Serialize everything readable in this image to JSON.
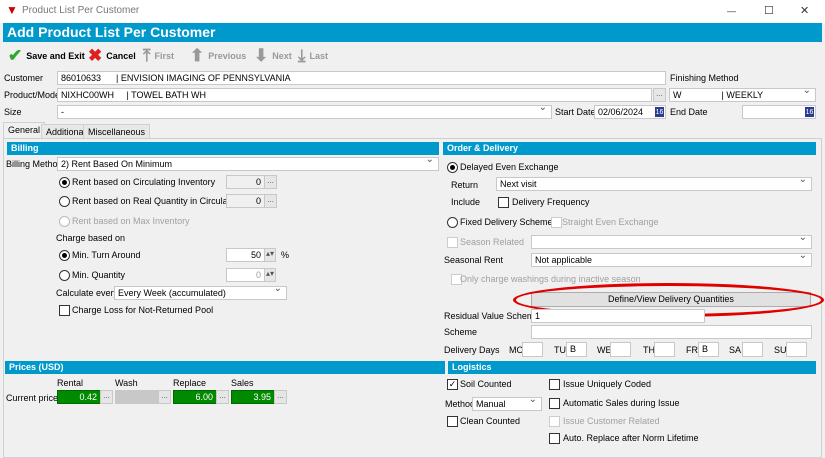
{
  "window": {
    "title": "Product List Per Customer",
    "minimize": "—",
    "maximize": "☐",
    "close": "✕"
  },
  "header": {
    "title": "Add Product List Per Customer"
  },
  "toolbar": {
    "save": "Save and Exit",
    "cancel": "Cancel",
    "first": "First",
    "previous": "Previous",
    "next": "Next",
    "last": "Last"
  },
  "form": {
    "customer_label": "Customer",
    "customer_value": "86010633      | ENVISION IMAGING OF PENNSYLVANIA",
    "product_label": "Product/Model",
    "product_value": "NIXHC00WH     | TOWEL BATH WH",
    "size_label": "Size",
    "size_value": "-",
    "finishing_label": "Finishing Method",
    "finishing_value": "W                | WEEKLY",
    "start_label": "Start Date",
    "start_value": "02/06/2024",
    "end_label": "End Date",
    "end_value": "",
    "calendar": "16"
  },
  "tabs": [
    "General",
    "Additional",
    "Miscellaneous"
  ],
  "billing": {
    "title": "Billing",
    "method_label": "Billing Method",
    "method_value": "2) Rent Based On Minimum",
    "opt1": "Rent based on Circulating Inventory",
    "opt1_value": "0",
    "opt2": "Rent based on Real Quantity in Circulation",
    "opt2_value": "0",
    "opt3": "Rent based on Max Inventory",
    "charge_label": "Charge based on",
    "min_turn": "Min. Turn Around",
    "min_turn_value": "50",
    "percent": "%",
    "min_qty": "Min. Quantity",
    "min_qty_value": "0",
    "calc_label": "Calculate every",
    "calc_value": "Every Week (accumulated)",
    "charge_loss": "Charge Loss for Not-Returned Pool",
    "dots": "..."
  },
  "order": {
    "title": "Order & Delivery",
    "delayed": "Delayed Even Exchange",
    "return_label": "Return",
    "return_value": "Next visit",
    "include_label": "Include",
    "delivery_freq": "Delivery Frequency",
    "fixed": "Fixed Delivery Scheme",
    "straight": "Straight Even Exchange",
    "season_related": "Season Related",
    "seasonal_rent_label": "Seasonal Rent",
    "seasonal_rent_value": "Not applicable",
    "only_charge": "Only charge washings during inactive season",
    "define_button": "Define/View Delivery Quantities",
    "residual_label": "Residual Value Scheme",
    "residual_value": "1",
    "scheme_label": "Scheme",
    "scheme_value": "",
    "days_label": "Delivery Days",
    "days": [
      {
        "d": "MO",
        "v": ""
      },
      {
        "d": "TU",
        "v": "B"
      },
      {
        "d": "WE",
        "v": ""
      },
      {
        "d": "TH",
        "v": ""
      },
      {
        "d": "FR",
        "v": "B"
      },
      {
        "d": "SA",
        "v": ""
      },
      {
        "d": "SU",
        "v": ""
      }
    ]
  },
  "prices": {
    "title": "Prices (USD)",
    "rental": "Rental",
    "wash": "Wash",
    "replace": "Replace",
    "sales": "Sales",
    "current_label": "Current price",
    "rental_value": "0.42",
    "wash_value": "",
    "replace_value": "6.00",
    "sales_value": "3.95"
  },
  "logistics": {
    "title": "Logistics",
    "soil": "Soil Counted",
    "soil_check": "✓",
    "method_label": "Method",
    "method_value": "Manual",
    "clean": "Clean Counted",
    "issue_unique": "Issue Uniquely Coded",
    "auto_sales": "Automatic Sales during Issue",
    "issue_customer": "Issue Customer Related",
    "auto_replace": "Auto. Replace after Norm Lifetime"
  },
  "colors": {
    "accent": "#0099cc",
    "highlight": "#e00000",
    "price_green": "#008a00"
  }
}
